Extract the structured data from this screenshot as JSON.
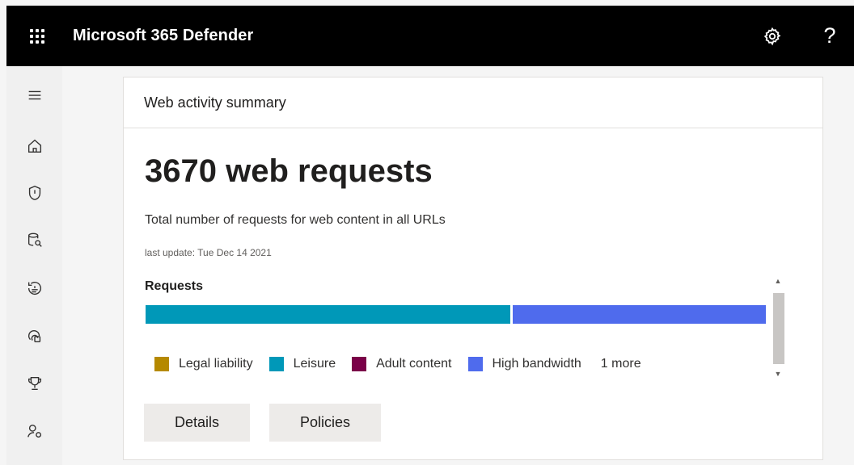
{
  "app": {
    "title": "Microsoft 365 Defender",
    "help_symbol": "?"
  },
  "card": {
    "title": "Web activity summary",
    "metric": "3670 web requests",
    "description": "Total number of requests for web content in all URLs",
    "updated": "last update: Tue Dec 14 2021",
    "section_title": "Requests",
    "more_label": "1 more"
  },
  "chart_data": {
    "type": "bar",
    "orientation": "horizontal-stacked",
    "series": [
      {
        "name": "Leisure",
        "share": 0.59,
        "color": "#0098b8"
      },
      {
        "name": "High bandwidth",
        "share": 0.41,
        "color": "#4f6bed"
      }
    ],
    "legend": [
      {
        "name": "Legal liability",
        "color": "#b58900"
      },
      {
        "name": "Leisure",
        "color": "#0098b8"
      },
      {
        "name": "Adult content",
        "color": "#7a0048"
      },
      {
        "name": "High bandwidth",
        "color": "#4f6bed"
      }
    ]
  },
  "buttons": {
    "details": "Details",
    "policies": "Policies"
  },
  "sidebar": {
    "items": [
      {
        "icon": "menu-icon"
      },
      {
        "icon": "home-icon"
      },
      {
        "icon": "shield-alert-icon"
      },
      {
        "icon": "database-search-icon"
      },
      {
        "icon": "history-icon"
      },
      {
        "icon": "fingerprint-icon"
      },
      {
        "icon": "trophy-icon"
      },
      {
        "icon": "user-settings-icon"
      }
    ]
  }
}
